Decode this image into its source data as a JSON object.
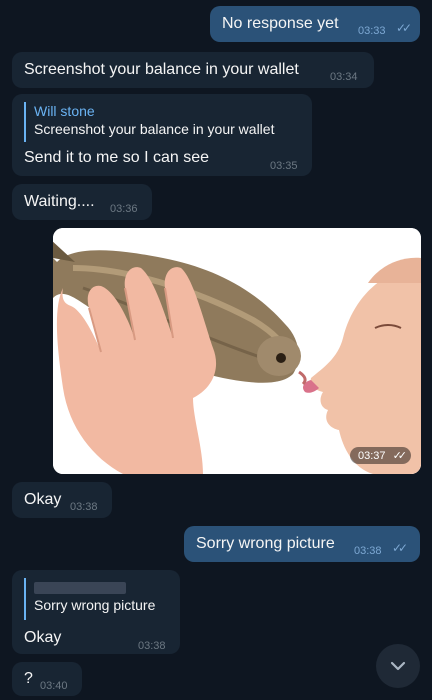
{
  "messages": {
    "m1": {
      "text": "No response yet",
      "time": "03:33"
    },
    "m2": {
      "text": "Screenshot your balance in your wallet",
      "time": "03:34"
    },
    "m3": {
      "reply_author": "Will stone",
      "reply_text": "Screenshot your balance in your wallet",
      "text": "Send it to me so I can see",
      "time": "03:35"
    },
    "m4": {
      "text": "Waiting....",
      "time": "03:36"
    },
    "m5": {
      "time": "03:37"
    },
    "m6": {
      "text": "Okay",
      "time": "03:38"
    },
    "m7": {
      "text": "Sorry wrong picture",
      "time": "03:38"
    },
    "m8": {
      "reply_text": "Sorry wrong picture",
      "text": "Okay",
      "time": "03:38"
    },
    "m9": {
      "text": "?",
      "time": "03:40"
    }
  },
  "icons": {
    "read_ticks": "double-check-icon",
    "scroll_down": "chevron-down-icon"
  },
  "colors": {
    "background": "#0e1621",
    "incoming_bubble": "#182533",
    "outgoing_bubble": "#2b5278",
    "accent": "#6ab3f3"
  }
}
